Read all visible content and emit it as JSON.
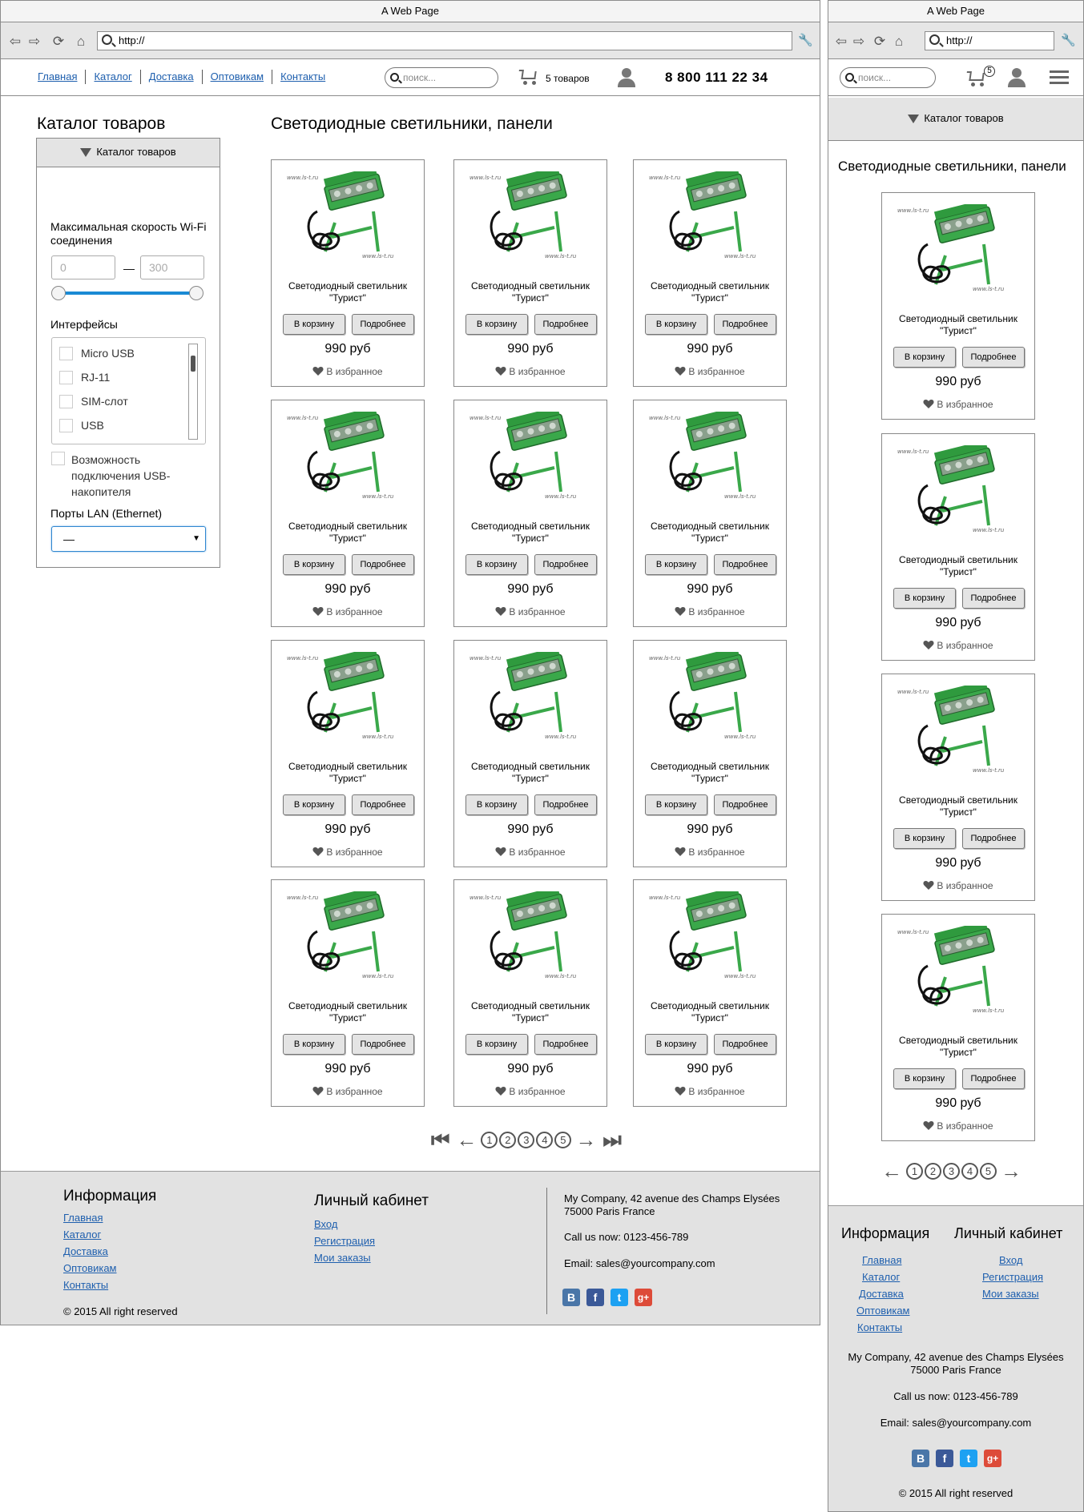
{
  "browser": {
    "title": "A Web Page",
    "url": "http://"
  },
  "nav": [
    "Главная",
    "Каталог",
    "Доставка",
    "Оптовикам",
    "Контакты"
  ],
  "search": {
    "placeholder": "поиск..."
  },
  "cart": {
    "label": "5 товаров",
    "count": "5"
  },
  "phone": "8 800 111 22 34",
  "sidebar": {
    "title": "Каталог товаров",
    "catalog_button": "Каталог товаров",
    "wifi_label": "Максимальная скорость Wi-Fi соединения",
    "range_min": "0",
    "range_dash": "—",
    "range_max": "300",
    "interfaces_label": "Интерфейсы",
    "interfaces": [
      "Micro USB",
      "RJ-11",
      "SIM-слот",
      "USB"
    ],
    "usb_label": "Возможность подключения USB-накопителя",
    "lan_label": "Порты LAN (Ethernet)",
    "lan_value": "—"
  },
  "main": {
    "title": "Светодиодные светильники, панели"
  },
  "product": {
    "name": "Светодиодный светильник \"Турист\"",
    "cart_btn": "В корзину",
    "more_btn": "Подробнее",
    "price": "990 руб",
    "fav": "В избранное",
    "watermark": "www.ls-t.ru"
  },
  "pager": {
    "pages": [
      "1",
      "2",
      "3",
      "4",
      "5"
    ]
  },
  "footer": {
    "info_title": "Информация",
    "info_links": [
      "Главная",
      "Каталог",
      "Доставка",
      "Оптовикам",
      "Контакты"
    ],
    "account_title": "Личный кабинет",
    "account_links": [
      "Вход",
      "Регистрация",
      "Мои заказы"
    ],
    "address": "My Company, 42 avenue des Champs Elysées 75000 Paris France",
    "phone": "Call us now: 0123-456-789",
    "email": "Email: sales@yourcompany.com",
    "copyright": "© 2015 All right reserved",
    "social": [
      "В",
      "f",
      "t",
      "g+"
    ]
  },
  "colors": {
    "link": "#1e5fae",
    "slider": "#1a8ad4",
    "footer_bg": "#e2e2e2",
    "product_green": "#3aa84a"
  }
}
